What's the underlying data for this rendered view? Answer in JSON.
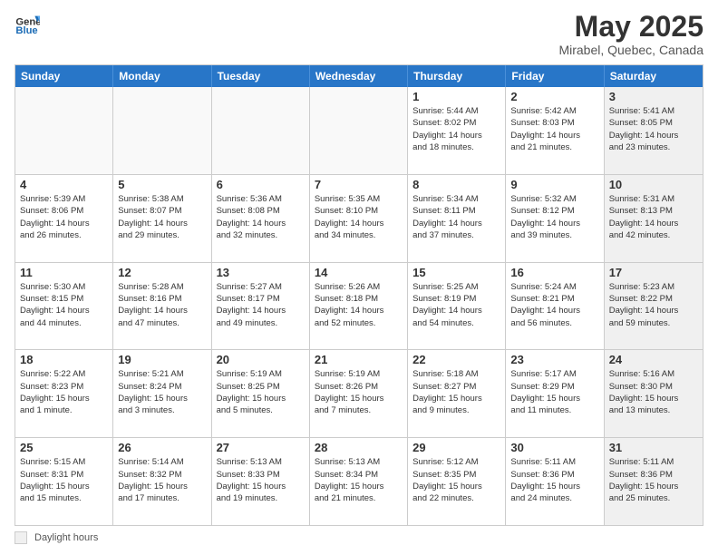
{
  "header": {
    "logo_line1": "General",
    "logo_line2": "Blue",
    "month_title": "May 2025",
    "subtitle": "Mirabel, Quebec, Canada"
  },
  "days_of_week": [
    "Sunday",
    "Monday",
    "Tuesday",
    "Wednesday",
    "Thursday",
    "Friday",
    "Saturday"
  ],
  "weeks": [
    [
      {
        "day": "",
        "info": "",
        "empty": true
      },
      {
        "day": "",
        "info": "",
        "empty": true
      },
      {
        "day": "",
        "info": "",
        "empty": true
      },
      {
        "day": "",
        "info": "",
        "empty": true
      },
      {
        "day": "1",
        "info": "Sunrise: 5:44 AM\nSunset: 8:02 PM\nDaylight: 14 hours\nand 18 minutes."
      },
      {
        "day": "2",
        "info": "Sunrise: 5:42 AM\nSunset: 8:03 PM\nDaylight: 14 hours\nand 21 minutes."
      },
      {
        "day": "3",
        "info": "Sunrise: 5:41 AM\nSunset: 8:05 PM\nDaylight: 14 hours\nand 23 minutes.",
        "shaded": true
      }
    ],
    [
      {
        "day": "4",
        "info": "Sunrise: 5:39 AM\nSunset: 8:06 PM\nDaylight: 14 hours\nand 26 minutes."
      },
      {
        "day": "5",
        "info": "Sunrise: 5:38 AM\nSunset: 8:07 PM\nDaylight: 14 hours\nand 29 minutes."
      },
      {
        "day": "6",
        "info": "Sunrise: 5:36 AM\nSunset: 8:08 PM\nDaylight: 14 hours\nand 32 minutes."
      },
      {
        "day": "7",
        "info": "Sunrise: 5:35 AM\nSunset: 8:10 PM\nDaylight: 14 hours\nand 34 minutes."
      },
      {
        "day": "8",
        "info": "Sunrise: 5:34 AM\nSunset: 8:11 PM\nDaylight: 14 hours\nand 37 minutes."
      },
      {
        "day": "9",
        "info": "Sunrise: 5:32 AM\nSunset: 8:12 PM\nDaylight: 14 hours\nand 39 minutes."
      },
      {
        "day": "10",
        "info": "Sunrise: 5:31 AM\nSunset: 8:13 PM\nDaylight: 14 hours\nand 42 minutes.",
        "shaded": true
      }
    ],
    [
      {
        "day": "11",
        "info": "Sunrise: 5:30 AM\nSunset: 8:15 PM\nDaylight: 14 hours\nand 44 minutes."
      },
      {
        "day": "12",
        "info": "Sunrise: 5:28 AM\nSunset: 8:16 PM\nDaylight: 14 hours\nand 47 minutes."
      },
      {
        "day": "13",
        "info": "Sunrise: 5:27 AM\nSunset: 8:17 PM\nDaylight: 14 hours\nand 49 minutes."
      },
      {
        "day": "14",
        "info": "Sunrise: 5:26 AM\nSunset: 8:18 PM\nDaylight: 14 hours\nand 52 minutes."
      },
      {
        "day": "15",
        "info": "Sunrise: 5:25 AM\nSunset: 8:19 PM\nDaylight: 14 hours\nand 54 minutes."
      },
      {
        "day": "16",
        "info": "Sunrise: 5:24 AM\nSunset: 8:21 PM\nDaylight: 14 hours\nand 56 minutes."
      },
      {
        "day": "17",
        "info": "Sunrise: 5:23 AM\nSunset: 8:22 PM\nDaylight: 14 hours\nand 59 minutes.",
        "shaded": true
      }
    ],
    [
      {
        "day": "18",
        "info": "Sunrise: 5:22 AM\nSunset: 8:23 PM\nDaylight: 15 hours\nand 1 minute."
      },
      {
        "day": "19",
        "info": "Sunrise: 5:21 AM\nSunset: 8:24 PM\nDaylight: 15 hours\nand 3 minutes."
      },
      {
        "day": "20",
        "info": "Sunrise: 5:19 AM\nSunset: 8:25 PM\nDaylight: 15 hours\nand 5 minutes."
      },
      {
        "day": "21",
        "info": "Sunrise: 5:19 AM\nSunset: 8:26 PM\nDaylight: 15 hours\nand 7 minutes."
      },
      {
        "day": "22",
        "info": "Sunrise: 5:18 AM\nSunset: 8:27 PM\nDaylight: 15 hours\nand 9 minutes."
      },
      {
        "day": "23",
        "info": "Sunrise: 5:17 AM\nSunset: 8:29 PM\nDaylight: 15 hours\nand 11 minutes."
      },
      {
        "day": "24",
        "info": "Sunrise: 5:16 AM\nSunset: 8:30 PM\nDaylight: 15 hours\nand 13 minutes.",
        "shaded": true
      }
    ],
    [
      {
        "day": "25",
        "info": "Sunrise: 5:15 AM\nSunset: 8:31 PM\nDaylight: 15 hours\nand 15 minutes."
      },
      {
        "day": "26",
        "info": "Sunrise: 5:14 AM\nSunset: 8:32 PM\nDaylight: 15 hours\nand 17 minutes."
      },
      {
        "day": "27",
        "info": "Sunrise: 5:13 AM\nSunset: 8:33 PM\nDaylight: 15 hours\nand 19 minutes."
      },
      {
        "day": "28",
        "info": "Sunrise: 5:13 AM\nSunset: 8:34 PM\nDaylight: 15 hours\nand 21 minutes."
      },
      {
        "day": "29",
        "info": "Sunrise: 5:12 AM\nSunset: 8:35 PM\nDaylight: 15 hours\nand 22 minutes."
      },
      {
        "day": "30",
        "info": "Sunrise: 5:11 AM\nSunset: 8:36 PM\nDaylight: 15 hours\nand 24 minutes."
      },
      {
        "day": "31",
        "info": "Sunrise: 5:11 AM\nSunset: 8:36 PM\nDaylight: 15 hours\nand 25 minutes.",
        "shaded": true
      }
    ]
  ],
  "footer": {
    "legend_label": "Daylight hours"
  }
}
